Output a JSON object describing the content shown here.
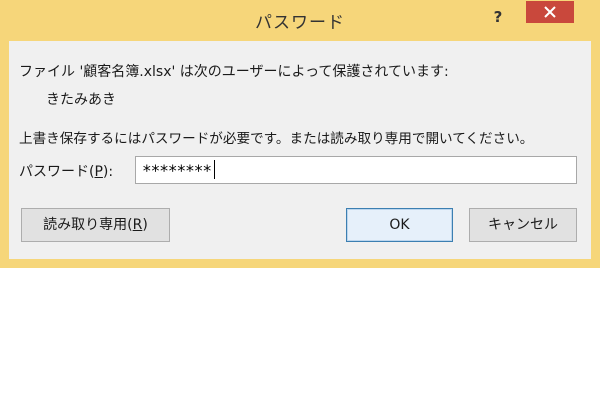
{
  "window": {
    "title": "パスワード",
    "help_label": "?",
    "close_icon": "close-icon"
  },
  "message": {
    "line1": "ファイル '顧客名簿.xlsx' は次のユーザーによって保護されています:",
    "user": "きたみあき",
    "line2": "上書き保存するにはパスワードが必要です。または読み取り専用で開いてください。"
  },
  "password": {
    "label_prefix": "パスワード(",
    "label_key": "P",
    "label_suffix": "):",
    "value": "********"
  },
  "buttons": {
    "readonly_prefix": "読み取り専用(",
    "readonly_key": "R",
    "readonly_suffix": ")",
    "ok": "OK",
    "cancel": "キャンセル"
  },
  "colors": {
    "frame": "#f6d67a",
    "close": "#c9483c",
    "client": "#f0f0f0"
  }
}
